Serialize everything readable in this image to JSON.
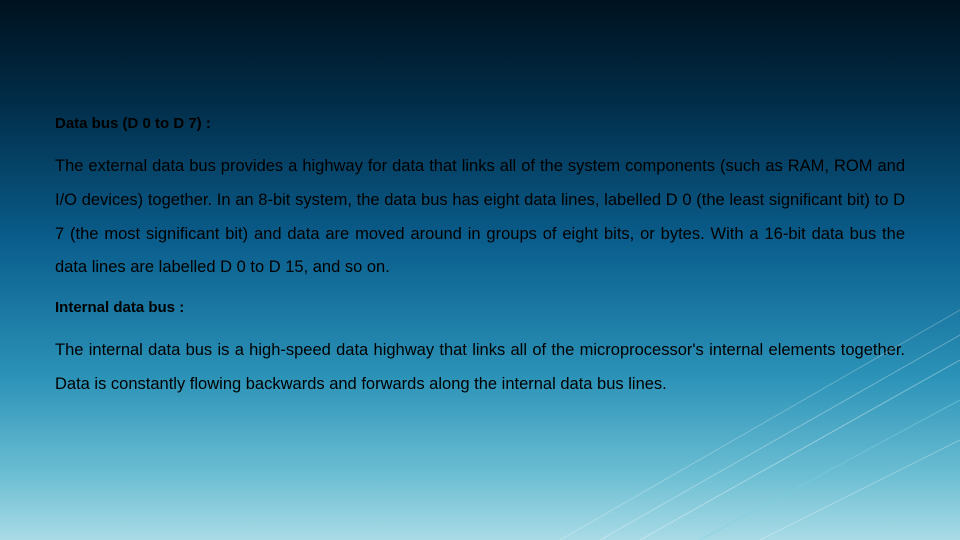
{
  "slide": {
    "section1": {
      "heading": "Data bus (D 0 to D 7) :",
      "body": "The external data bus provides a highway for data that links all of the system components (such as RAM, ROM and I/O devices) together. In an 8-bit system, the data bus has eight data lines, labelled D 0 (the least significant bit) to D 7 (the most significant bit) and data are moved around in groups of eight bits, or bytes. With a 16-bit data bus the data lines are labelled D 0 to D 15, and so on."
    },
    "section2": {
      "heading": "Internal data bus :",
      "body": "The internal data bus is a high-speed data highway that links all of the microprocessor's internal elements together. Data is constantly flowing backwards and forwards along the internal data bus lines."
    }
  }
}
